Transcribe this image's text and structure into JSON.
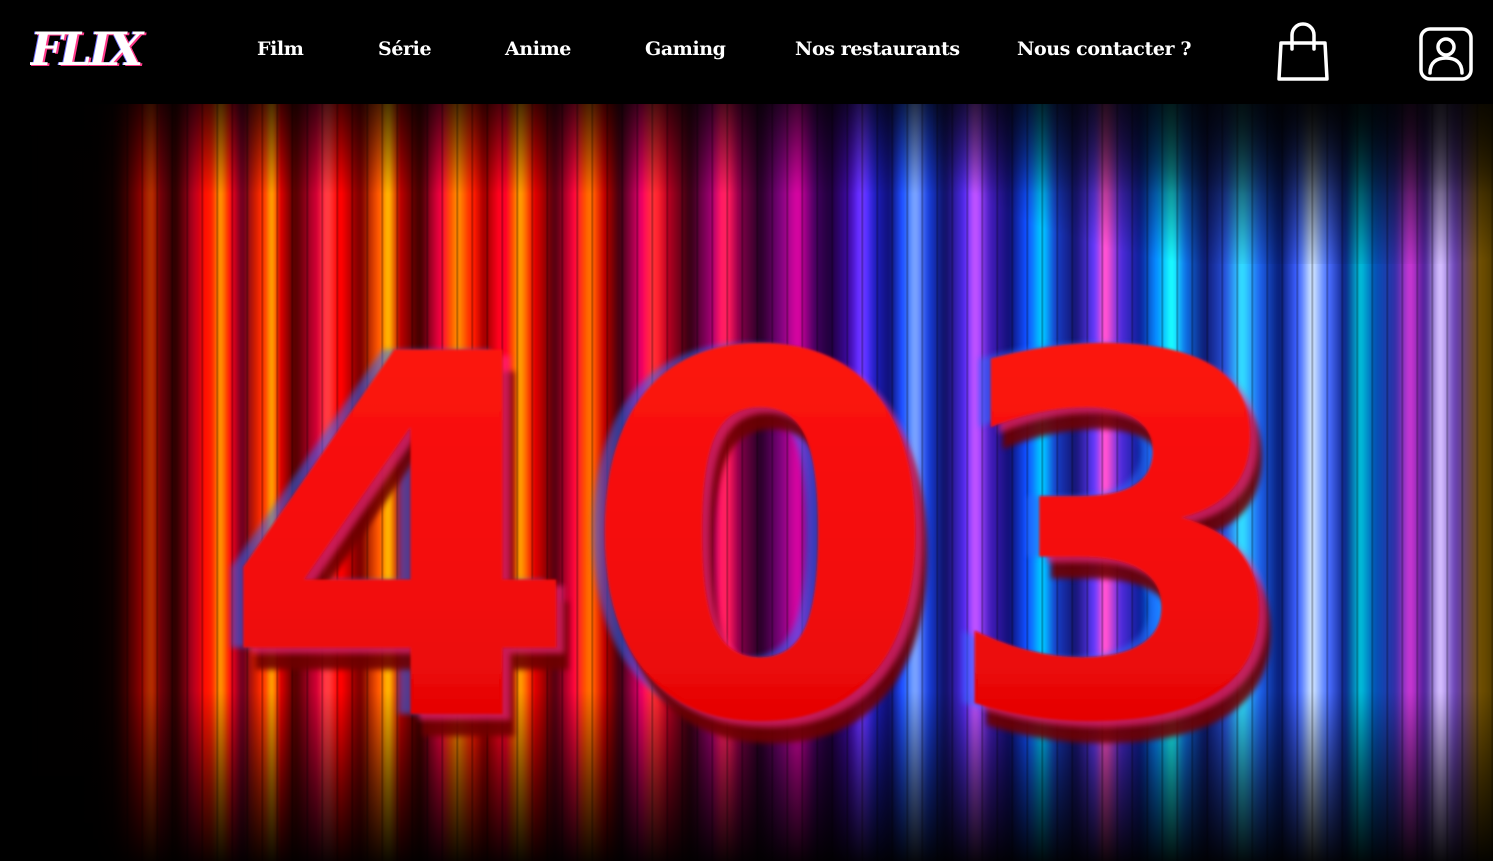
{
  "header": {
    "logo_text": "FLIX",
    "nav": [
      {
        "label": "Film"
      },
      {
        "label": "Série"
      },
      {
        "label": "Anime"
      },
      {
        "label": "Gaming"
      },
      {
        "label": "Nos restaurants"
      },
      {
        "label": "Nous contacter ?"
      }
    ],
    "cart_icon": "shopping-bag-icon",
    "account_icon": "user-account-icon"
  },
  "hero": {
    "error_code": "403"
  },
  "colors": {
    "header_bg": "#000000",
    "nav_text": "#ffffff",
    "digit_red": "#ff0a0a",
    "digit_shadow": "#7a0000"
  }
}
